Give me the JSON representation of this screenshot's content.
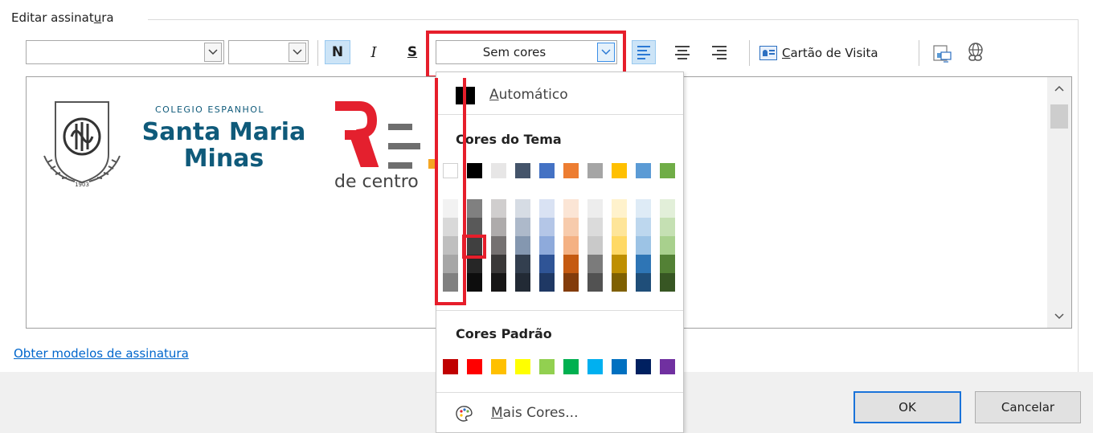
{
  "window": {
    "group_title_prefix": "Editar assinat",
    "group_title_mnemonic": "u",
    "group_title_suffix": "ra"
  },
  "toolbar": {
    "font_name_value": "",
    "font_size_value": "",
    "bold_label": "N",
    "italic_label": "I",
    "underline_label": "S",
    "color_value": "Sem cores",
    "card_mnemonic": "C",
    "card_label_rest": "artão de Visita",
    "buttons": [
      "bold",
      "italic",
      "underline",
      "align-left",
      "align-center",
      "align-right",
      "business-card",
      "insert-picture",
      "insert-hyperlink"
    ]
  },
  "editor": {
    "logo_school_small": "COLEGIO ESPANHOL",
    "logo_school_line1": "Santa Maria",
    "logo_school_line2": "Minas",
    "logo_seal_year": "1903",
    "logo_rede_partial": "de centro",
    "scroll_up": "^",
    "scroll_down": "v"
  },
  "templates_link": "Obter modelos de assinatura",
  "dialog_buttons": {
    "ok": "OK",
    "cancel": "Cancelar"
  },
  "color_menu": {
    "auto_mnemonic": "A",
    "auto_label_rest": "utomático",
    "theme_heading": "Cores do Tema",
    "standard_heading": "Cores Padrão",
    "more_mnemonic": "M",
    "more_label_rest": "ais Cores...",
    "theme_top_row": [
      "#ffffff",
      "#000000",
      "#e7e6e6",
      "#44546a",
      "#4472c4",
      "#ed7d31",
      "#a5a5a5",
      "#ffc000",
      "#5b9bd5",
      "#70ad47"
    ],
    "theme_shades": [
      [
        "#f2f2f2",
        "#d9d9d9",
        "#bfbfbf",
        "#a6a6a6",
        "#808080"
      ],
      [
        "#808080",
        "#595959",
        "#404040",
        "#262626",
        "#0d0d0d"
      ],
      [
        "#d0cece",
        "#aeabab",
        "#757171",
        "#3a3838",
        "#171616"
      ],
      [
        "#d6dce4",
        "#adb9ca",
        "#8497b0",
        "#333f4f",
        "#222a35"
      ],
      [
        "#d9e2f3",
        "#b4c6e7",
        "#8eaadb",
        "#2f5496",
        "#1f3864"
      ],
      [
        "#fbe5d5",
        "#f7cbac",
        "#f4b183",
        "#c55a11",
        "#833c0b"
      ],
      [
        "#ededed",
        "#dbdbdb",
        "#c9c9c9",
        "#7b7b7b",
        "#525252"
      ],
      [
        "#fff2cc",
        "#fee599",
        "#ffd965",
        "#bf8f00",
        "#7f6000"
      ],
      [
        "#deebf6",
        "#bdd7ee",
        "#9cc3e5",
        "#2e75b5",
        "#1f4e79"
      ],
      [
        "#e2efd9",
        "#c5e0b3",
        "#a8d08d",
        "#538135",
        "#375623"
      ]
    ],
    "standard_colors": [
      "#c00000",
      "#ff0000",
      "#ffc000",
      "#ffff00",
      "#92d050",
      "#00b050",
      "#00b0f0",
      "#0070c0",
      "#002060",
      "#7030a0"
    ]
  },
  "colors": {
    "annotation_red": "#e61e2b",
    "selection_blue": "#cce4f7",
    "link_blue": "#0066cc",
    "logo_teal": "#0f5a7a",
    "logo_red": "#e4202e",
    "logo_gray": "#6e6e6e",
    "logo_orange": "#f5a623"
  }
}
